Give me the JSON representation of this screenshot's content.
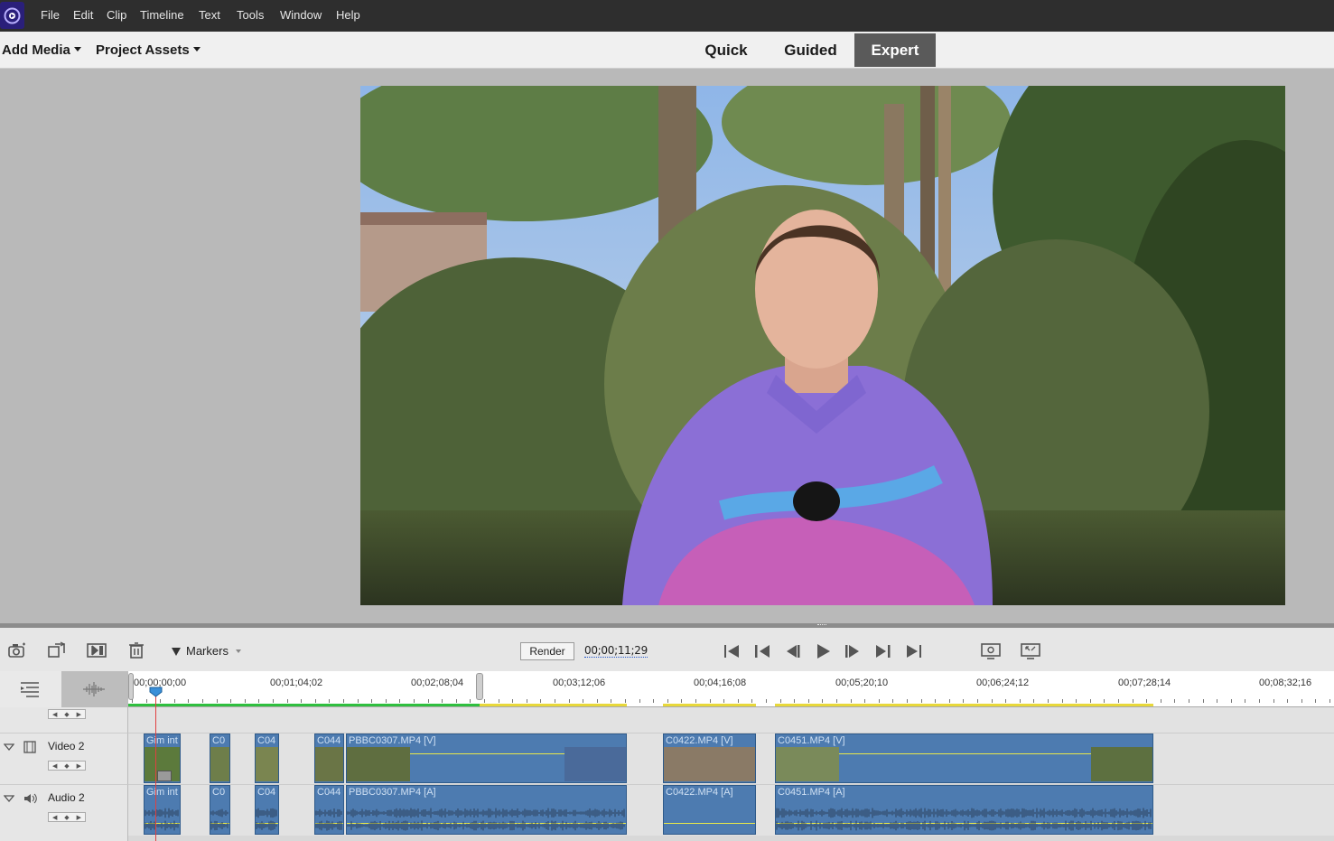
{
  "menubar": {
    "items": [
      "File",
      "Edit",
      "Clip",
      "Timeline",
      "Text",
      "Tools",
      "Window",
      "Help"
    ]
  },
  "modebar": {
    "add_media": "Add Media",
    "project_assets": "Project Assets",
    "tabs": [
      "Quick",
      "Guided",
      "Expert"
    ],
    "active_tab": "Expert"
  },
  "toolbar": {
    "markers_label": "Markers",
    "render_label": "Render",
    "timecode": "00;00;11;29"
  },
  "ruler": {
    "labels": [
      "00;00;00;00",
      "00;01;04;02",
      "00;02;08;04",
      "00;03;12;06",
      "00;04;16;08",
      "00;05;20;10",
      "00;06;24;12",
      "00;07;28;14",
      "00;08;32;16"
    ]
  },
  "tracks": {
    "video_name": "Video 2",
    "audio_name": "Audio 2",
    "video_clips": [
      "Gim int",
      "C0",
      "C04",
      "C044",
      "PBBC0307.MP4 [V]",
      "C0422.MP4 [V]",
      "C0451.MP4 [V]"
    ],
    "audio_clips": [
      "Gim int",
      "C0",
      "C04",
      "C044",
      "PBBC0307.MP4 [A]",
      "C0422.MP4 [A]",
      "C0451.MP4 [A]"
    ]
  },
  "colors": {
    "clip_blue": "#4d7bb0",
    "render_green": "#2fbf3f",
    "render_yellow": "#e8d83a",
    "playhead": "#e04040"
  }
}
